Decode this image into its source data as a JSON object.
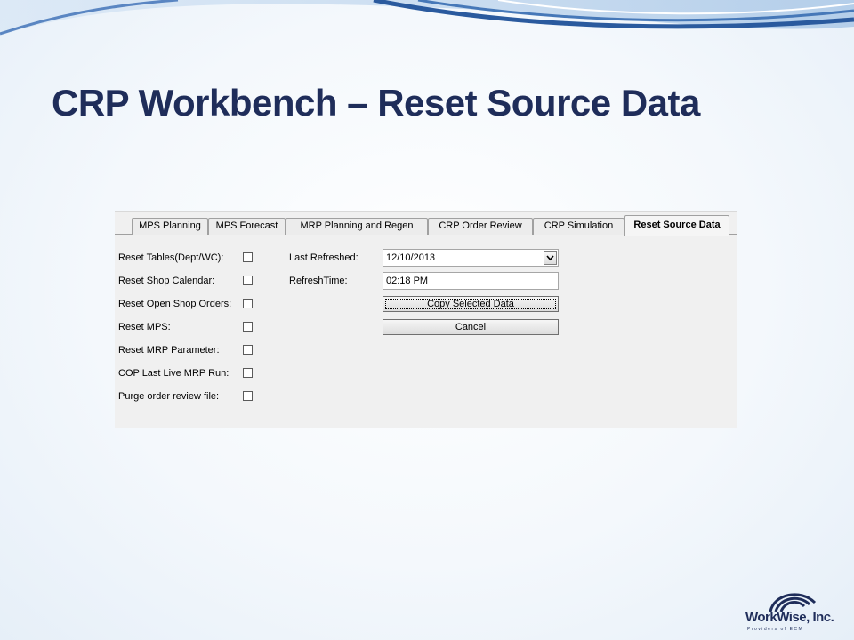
{
  "slide": {
    "title": "CRP Workbench – Reset Source Data"
  },
  "tabs": [
    {
      "label": "MPS Planning"
    },
    {
      "label": "MPS Forecast"
    },
    {
      "label": "MRP Planning and Regen"
    },
    {
      "label": "CRP Order Review"
    },
    {
      "label": "CRP Simulation"
    },
    {
      "label": "Reset Source Data",
      "active": true
    }
  ],
  "reset_options": [
    {
      "label": "Reset Tables(Dept/WC):",
      "checked": false
    },
    {
      "label": "Reset Shop Calendar:",
      "checked": false
    },
    {
      "label": "Reset Open Shop Orders:",
      "checked": false
    },
    {
      "label": "Reset MPS:",
      "checked": false
    },
    {
      "label": "Reset MRP Parameter:",
      "checked": false
    },
    {
      "label": "COP Last Live MRP Run:",
      "checked": false
    },
    {
      "label": "Purge order review file:",
      "checked": false
    }
  ],
  "fields": {
    "last_refreshed_label": "Last Refreshed:",
    "last_refreshed_value": "12/10/2013",
    "refresh_time_label": "RefreshTime:",
    "refresh_time_value": "02:18 PM"
  },
  "buttons": {
    "copy_label": "Copy Selected Data",
    "cancel_label": "Cancel"
  },
  "logo": {
    "name": "WorkWise, Inc.",
    "tagline": "Providers of ECM"
  },
  "colors": {
    "title": "#1f2d5a",
    "swoosh": "#2a5a9e"
  },
  "icons": {
    "dropdown": "chevron-down-icon",
    "logo": "workwise-logo-icon"
  }
}
